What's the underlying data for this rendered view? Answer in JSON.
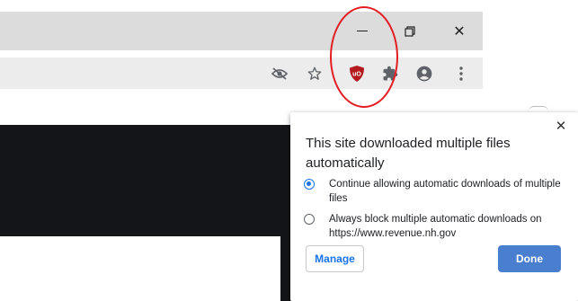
{
  "window": {
    "minimize_icon": "minimize-icon",
    "restore_icon": "restore-icon",
    "close_label": "✕"
  },
  "toolbar": {
    "icons": [
      "eye-off-icon",
      "star-icon",
      "ublock-origin-icon",
      "extensions-puzzle-icon",
      "account-icon",
      "more-menu-icon"
    ],
    "ublock_badge": "uO",
    "ublock_color": "#b4191e"
  },
  "annotation": {
    "color": "#e31d23"
  },
  "dialog": {
    "title": "This site downloaded multiple files automatically",
    "close_label": "✕",
    "options": [
      {
        "label": "Continue allowing automatic downloads of multiple files",
        "selected": true
      },
      {
        "label": "Always block multiple automatic downloads on https://www.revenue.nh.gov",
        "selected": false
      }
    ],
    "manage_label": "Manage",
    "done_label": "Done",
    "accent": "#1a73e8",
    "done_bg": "#4a7fcf"
  }
}
